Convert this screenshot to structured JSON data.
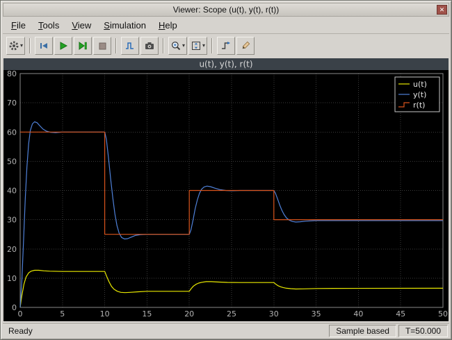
{
  "window": {
    "title": "Viewer: Scope (u(t), y(t), r(t))"
  },
  "icons": {
    "dropdown_arrow": "▾",
    "close": "✕"
  },
  "menu": {
    "items": [
      {
        "label": "File"
      },
      {
        "label": "Tools"
      },
      {
        "label": "View"
      },
      {
        "label": "Simulation"
      },
      {
        "label": "Help"
      }
    ]
  },
  "toolbar": {
    "buttons": [
      "settings",
      "step-back",
      "run",
      "step-forward",
      "stop",
      "highlight-signal",
      "snapshot",
      "zoom",
      "fit-to-view",
      "triggers",
      "measurements"
    ]
  },
  "statusbar": {
    "status": "Ready",
    "sample_mode": "Sample based",
    "time": "T=50.000"
  },
  "chart_data": {
    "type": "line",
    "title": "u(t), y(t), r(t)",
    "xlabel": "",
    "ylabel": "",
    "xlim": [
      0,
      50
    ],
    "ylim": [
      0,
      80
    ],
    "xticks": [
      0,
      5,
      10,
      15,
      20,
      25,
      30,
      35,
      40,
      45,
      50
    ],
    "yticks": [
      0,
      10,
      20,
      30,
      40,
      50,
      60,
      70,
      80
    ],
    "grid": true,
    "legend_position": "top-right",
    "colors": {
      "background": "#000000",
      "title_band": "#3a4148",
      "title_text": "#d9d9d9",
      "grid": "#3c3c3c",
      "tick_text": "#b4b4b4",
      "axes_border": "#8a8a8a",
      "legend_border": "#c8c8c8",
      "legend_text": "#e6e6e6"
    },
    "series": [
      {
        "name": "u(t)",
        "color": "#e9e900",
        "legend_glyph": "line",
        "points": [
          [
            0,
            0
          ],
          [
            0.2,
            4
          ],
          [
            0.45,
            8
          ],
          [
            0.7,
            10.4
          ],
          [
            1,
            11.8
          ],
          [
            1.3,
            12.4
          ],
          [
            1.7,
            12.7
          ],
          [
            2.2,
            12.7
          ],
          [
            2.8,
            12.5
          ],
          [
            3.5,
            12.4
          ],
          [
            5,
            12.3
          ],
          [
            10,
            12.3
          ],
          [
            10.25,
            10.5
          ],
          [
            10.5,
            8.8
          ],
          [
            10.8,
            7.2
          ],
          [
            11.1,
            6.2
          ],
          [
            11.5,
            5.5
          ],
          [
            11.9,
            5.15
          ],
          [
            12.4,
            5.05
          ],
          [
            13,
            5.15
          ],
          [
            14,
            5.35
          ],
          [
            15,
            5.5
          ],
          [
            20,
            5.5
          ],
          [
            20.25,
            6.5
          ],
          [
            20.5,
            7.3
          ],
          [
            20.8,
            7.9
          ],
          [
            21.1,
            8.3
          ],
          [
            21.5,
            8.6
          ],
          [
            22,
            8.8
          ],
          [
            22.6,
            8.8
          ],
          [
            23.3,
            8.7
          ],
          [
            24.5,
            8.55
          ],
          [
            26,
            8.5
          ],
          [
            30,
            8.5
          ],
          [
            30.25,
            7.9
          ],
          [
            30.5,
            7.4
          ],
          [
            30.8,
            7.05
          ],
          [
            31.1,
            6.8
          ],
          [
            31.5,
            6.55
          ],
          [
            32,
            6.4
          ],
          [
            32.6,
            6.3
          ],
          [
            33.5,
            6.35
          ],
          [
            35,
            6.45
          ],
          [
            37,
            6.5
          ],
          [
            50,
            6.55
          ]
        ]
      },
      {
        "name": "y(t)",
        "color": "#4f81d9",
        "legend_glyph": "line",
        "points": [
          [
            0,
            0
          ],
          [
            0.2,
            9
          ],
          [
            0.4,
            23
          ],
          [
            0.6,
            37
          ],
          [
            0.8,
            48
          ],
          [
            1,
            56
          ],
          [
            1.2,
            60.5
          ],
          [
            1.45,
            62.8
          ],
          [
            1.7,
            63.5
          ],
          [
            2,
            63.2
          ],
          [
            2.3,
            62.2
          ],
          [
            2.7,
            61
          ],
          [
            3.1,
            60.3
          ],
          [
            3.6,
            59.9
          ],
          [
            4.2,
            59.8
          ],
          [
            5,
            60
          ],
          [
            10,
            60
          ],
          [
            10.2,
            57.5
          ],
          [
            10.45,
            51
          ],
          [
            10.7,
            44
          ],
          [
            10.95,
            37.5
          ],
          [
            11.2,
            32
          ],
          [
            11.45,
            28
          ],
          [
            11.7,
            25.4
          ],
          [
            12,
            23.9
          ],
          [
            12.35,
            23.4
          ],
          [
            12.7,
            23.5
          ],
          [
            13.1,
            24
          ],
          [
            13.6,
            24.6
          ],
          [
            14.2,
            24.9
          ],
          [
            15,
            25
          ],
          [
            20,
            25
          ],
          [
            20.2,
            26.5
          ],
          [
            20.45,
            30
          ],
          [
            20.7,
            33.8
          ],
          [
            20.95,
            36.8
          ],
          [
            21.2,
            39
          ],
          [
            21.45,
            40.4
          ],
          [
            21.75,
            41.2
          ],
          [
            22.1,
            41.5
          ],
          [
            22.5,
            41.3
          ],
          [
            23,
            40.8
          ],
          [
            23.6,
            40.3
          ],
          [
            24.3,
            40
          ],
          [
            25,
            39.9
          ],
          [
            26,
            40
          ],
          [
            30,
            40
          ],
          [
            30.2,
            39
          ],
          [
            30.45,
            37
          ],
          [
            30.7,
            35
          ],
          [
            30.95,
            33.2
          ],
          [
            31.2,
            31.8
          ],
          [
            31.5,
            30.6
          ],
          [
            31.85,
            29.8
          ],
          [
            32.2,
            29.4
          ],
          [
            32.6,
            29.2
          ],
          [
            33.1,
            29.3
          ],
          [
            33.8,
            29.5
          ],
          [
            35,
            29.7
          ],
          [
            40,
            29.7
          ],
          [
            50,
            29.7
          ]
        ]
      },
      {
        "name": "r(t)",
        "color": "#d9541c",
        "legend_glyph": "step",
        "points": [
          [
            0,
            60
          ],
          [
            10,
            60
          ],
          [
            10,
            25
          ],
          [
            20,
            25
          ],
          [
            20,
            40
          ],
          [
            30,
            40
          ],
          [
            30,
            30
          ],
          [
            50,
            30
          ]
        ]
      }
    ]
  }
}
